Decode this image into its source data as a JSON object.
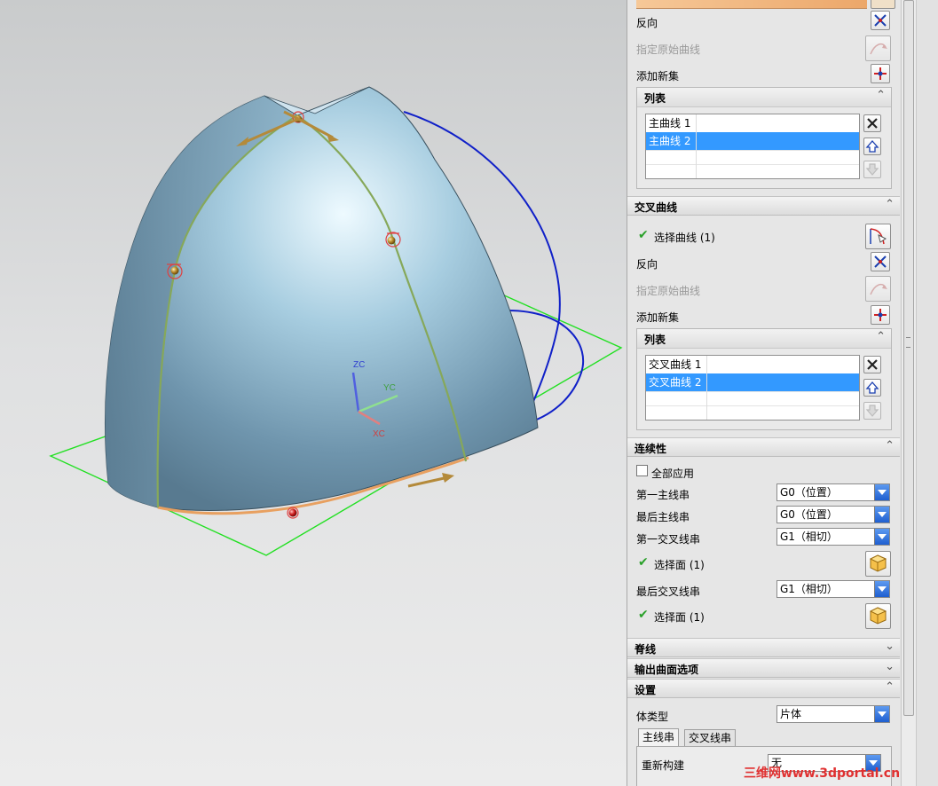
{
  "viewport": {
    "axis_labels": {
      "zc": "ZC",
      "yc": "YC",
      "xc": "XC"
    },
    "colors": {
      "surface": "#8fb6cc",
      "plane": "#22e022",
      "guide_curve": "#1020c8",
      "edge": "#e8a060"
    }
  },
  "panel": {
    "top_accent_color": "#f0b070",
    "section1": {
      "reverse_label": "反向",
      "specify_origin_label": "指定原始曲线",
      "add_new_set_label": "添加新集",
      "list": {
        "title": "列表",
        "items": [
          {
            "label": "主曲线 1",
            "selected": false
          },
          {
            "label": "主曲线 2",
            "selected": true
          }
        ]
      }
    },
    "cross_curves": {
      "title": "交叉曲线",
      "select_curve_label": "选择曲线 (1)",
      "reverse_label": "反向",
      "specify_origin_label": "指定原始曲线",
      "add_new_set_label": "添加新集",
      "list": {
        "title": "列表",
        "items": [
          {
            "label": "交叉曲线 1",
            "selected": false
          },
          {
            "label": "交叉曲线 2",
            "selected": true
          }
        ]
      }
    },
    "continuity": {
      "title": "连续性",
      "apply_all_label": "全部应用",
      "apply_all_checked": false,
      "first_primary_label": "第一主线串",
      "first_primary_value": "G0（位置）",
      "last_primary_label": "最后主线串",
      "last_primary_value": "G0（位置）",
      "first_cross_label": "第一交叉线串",
      "first_cross_value": "G1（相切）",
      "select_face1_label": "选择面 (1)",
      "last_cross_label": "最后交叉线串",
      "last_cross_value": "G1（相切）",
      "select_face2_label": "选择面 (1)"
    },
    "spine": {
      "title": "脊线"
    },
    "output_options": {
      "title": "输出曲面选项"
    },
    "settings": {
      "title": "设置",
      "body_type_label": "体类型",
      "body_type_value": "片体",
      "tabs": [
        "主线串",
        "交叉线串"
      ],
      "active_tab": 0,
      "rebuild_label": "重新构建",
      "rebuild_value": "无"
    }
  },
  "watermark": "三维网www.3dportal.cn"
}
